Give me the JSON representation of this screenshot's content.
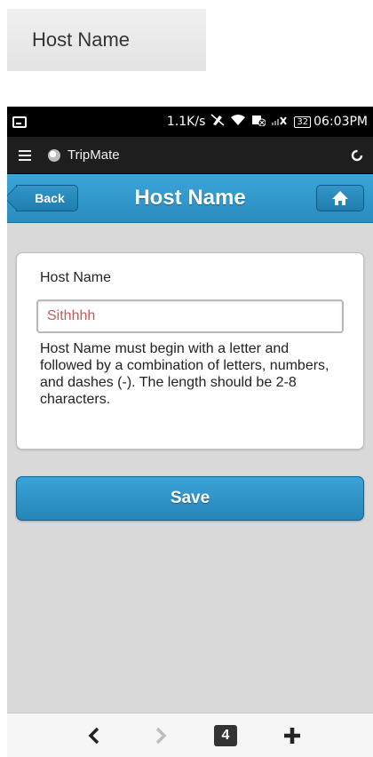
{
  "caption": {
    "text": "Host Name"
  },
  "status_bar": {
    "speed": "1.1K/s",
    "battery": "32",
    "time": "06:03PM",
    "icons": [
      "screenshot-icon",
      "mute-icon",
      "wifi-icon",
      "sync-off-icon",
      "signal-icon",
      "battery-icon"
    ]
  },
  "app_bar": {
    "app_name": "TripMate",
    "icons": [
      "menu-icon",
      "app-logo-icon",
      "refresh-icon"
    ]
  },
  "nav": {
    "back_label": "Back",
    "title": "Host Name",
    "home_icon": "home-icon"
  },
  "form": {
    "label": "Host Name",
    "value": "Sithhhh",
    "help": "Host Name must begin with a letter and followed by a combination of letters, numbers, and dashes (-). The length should be 2-8 characters."
  },
  "save_label": "Save",
  "browser_bar": {
    "tab_count": "4",
    "icons": [
      "back-arrow-icon",
      "forward-arrow-icon",
      "tabs-icon",
      "new-tab-icon"
    ]
  },
  "colors": {
    "accent": "#2f97cc",
    "input_text": "#c25b5b",
    "background": "#d9d9d9"
  }
}
